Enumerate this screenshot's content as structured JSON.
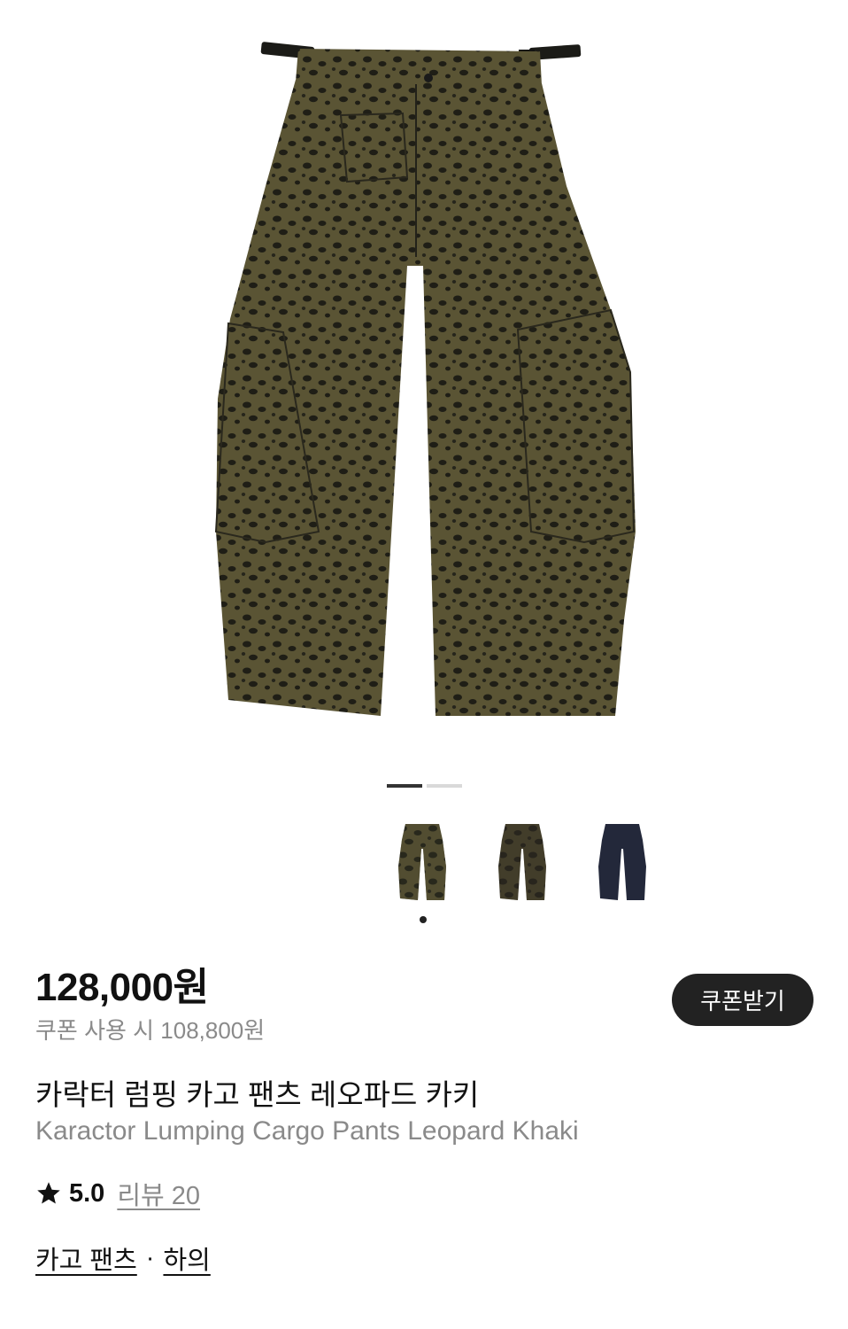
{
  "product": {
    "image_icon": "leopard-cargo-pants-image",
    "gallery_pages": 2,
    "gallery_active_index": 0,
    "price": "128,000원",
    "coupon_price": "쿠폰 사용 시 108,800원",
    "coupon_button_label": "쿠폰받기",
    "title_ko": "카락터 럼핑 카고 팬츠 레오파드 카키",
    "title_en": "Karactor Lumping Cargo Pants Leopard Khaki",
    "rating": "5.0",
    "reviews_label": "리뷰 20",
    "category_primary": "카고 팬츠",
    "category_separator": "·",
    "category_secondary": "하의"
  },
  "variants": [
    {
      "name": "leopard-khaki",
      "color": "#3e3e2a",
      "selected": true
    },
    {
      "name": "leopard-brown",
      "color": "#2f2a22",
      "selected": false
    },
    {
      "name": "navy",
      "color": "#23283a",
      "selected": false
    }
  ],
  "colors": {
    "accent_dark": "#222222",
    "muted_text": "#8a8a8a",
    "pager_active": "#333333",
    "pager_inactive": "#d9d9d9"
  }
}
